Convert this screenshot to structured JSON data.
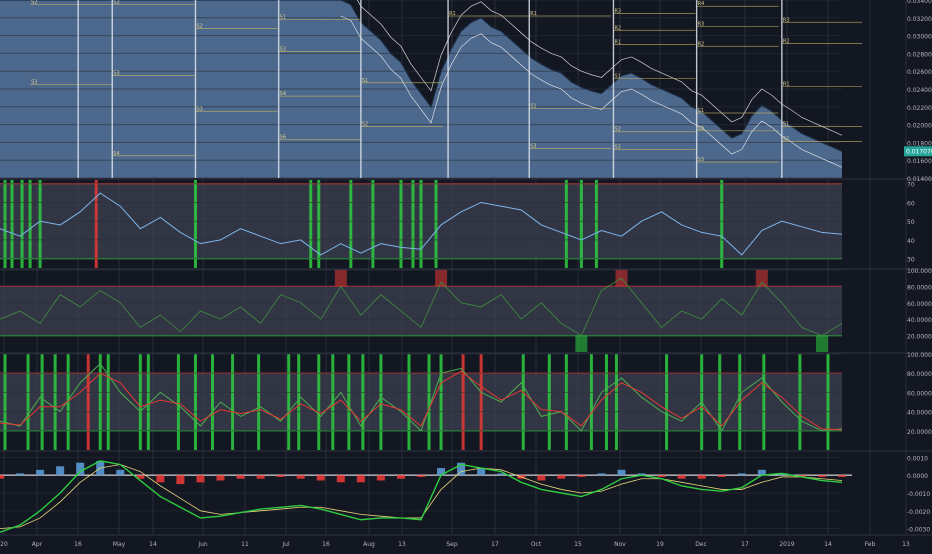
{
  "colors": {
    "background": "#131722",
    "price_area": "#4f6d92",
    "grid": "#2a2e39",
    "axis_text": "#b2b5be",
    "bull_candle": "#26a69a",
    "bear_candle": "#ef5350",
    "band_line": "#ffffff",
    "pivot_line": "#c8b560",
    "rsi_line": "#7cb5ec",
    "signal_green": "#2ecc40",
    "signal_red": "#e53935",
    "osc_fill": "#3d4150",
    "stoch_k": "#4caf50",
    "stoch_d": "#e53935",
    "macd_hist_pos": "#5b9bd5",
    "macd_hist_neg": "#e53935",
    "price_label_bg": "#26a69a"
  },
  "chart_data": [
    {
      "type": "line",
      "panel": "price",
      "y_tick_labels": [
        "0.034000",
        "0.032000",
        "0.030000",
        "0.028000",
        "0.026000",
        "0.024000",
        "0.022000",
        "0.020000",
        "0.018000",
        "0.016000",
        "0.014000"
      ],
      "ylim": [
        0.014,
        0.034
      ],
      "current_price_label": "0.017070",
      "x": [
        0,
        10,
        20,
        30,
        40,
        50,
        60,
        70,
        80,
        90,
        100,
        110,
        120,
        130,
        140,
        150,
        160,
        170,
        180,
        190,
        200,
        210,
        220,
        230,
        240,
        250,
        260,
        270,
        280,
        290,
        300,
        310,
        320,
        330,
        340,
        350,
        360,
        370,
        380,
        390,
        400,
        410,
        420,
        430,
        440,
        450,
        460,
        470,
        480,
        490,
        500,
        510,
        520,
        530,
        540,
        550,
        560,
        570,
        580,
        590,
        600,
        610,
        620,
        630,
        640,
        650,
        660,
        670,
        680,
        690,
        700,
        710,
        720,
        730,
        740,
        750,
        760,
        770,
        780,
        790,
        800,
        810,
        820,
        830,
        840
      ],
      "values": [
        0.0345,
        0.0345,
        0.0345,
        0.0345,
        0.0345,
        0.0345,
        0.0345,
        0.0345,
        0.0345,
        0.0345,
        0.0345,
        0.0345,
        0.0345,
        0.0345,
        0.0345,
        0.0345,
        0.0345,
        0.0345,
        0.0345,
        0.0345,
        0.0345,
        0.0345,
        0.0345,
        0.0345,
        0.0345,
        0.0345,
        0.0345,
        0.0345,
        0.0345,
        0.0345,
        0.0345,
        0.0345,
        0.0345,
        0.0345,
        0.034,
        0.0335,
        0.0315,
        0.0305,
        0.0295,
        0.028,
        0.027,
        0.025,
        0.0235,
        0.022,
        0.026,
        0.0285,
        0.0305,
        0.0315,
        0.032,
        0.031,
        0.0305,
        0.0295,
        0.0285,
        0.0275,
        0.0268,
        0.0262,
        0.0258,
        0.0248,
        0.0242,
        0.0238,
        0.0235,
        0.0245,
        0.0255,
        0.0258,
        0.0252,
        0.0245,
        0.024,
        0.0235,
        0.023,
        0.022,
        0.0215,
        0.0205,
        0.0195,
        0.0185,
        0.019,
        0.021,
        0.0222,
        0.0215,
        0.0205,
        0.0198,
        0.019,
        0.0185,
        0.018,
        0.0175,
        0.017
      ],
      "pivot_labels": [
        {
          "label": "S2",
          "x": 30,
          "y": 0.0335
        },
        {
          "label": "S2",
          "x": 112,
          "y": 0.0335
        },
        {
          "label": "S3",
          "x": 30,
          "y": 0.0245
        },
        {
          "label": "S3",
          "x": 112,
          "y": 0.0255
        },
        {
          "label": "S2",
          "x": 195,
          "y": 0.0308
        },
        {
          "label": "S3",
          "x": 195,
          "y": 0.0215
        },
        {
          "label": "S4",
          "x": 112,
          "y": 0.0165
        },
        {
          "label": "S1",
          "x": 278,
          "y": 0.0318
        },
        {
          "label": "S3",
          "x": 278,
          "y": 0.0282
        },
        {
          "label": "S4",
          "x": 278,
          "y": 0.0232
        },
        {
          "label": "S6",
          "x": 278,
          "y": 0.0183
        },
        {
          "label": "S1",
          "x": 360,
          "y": 0.0247
        },
        {
          "label": "S2",
          "x": 360,
          "y": 0.0198
        },
        {
          "label": "R1",
          "x": 447,
          "y": 0.0322
        },
        {
          "label": "R1",
          "x": 528,
          "y": 0.0322
        },
        {
          "label": "S1",
          "x": 528,
          "y": 0.0218
        },
        {
          "label": "S3",
          "x": 528,
          "y": 0.0173
        },
        {
          "label": "R3",
          "x": 612,
          "y": 0.0325
        },
        {
          "label": "R2",
          "x": 612,
          "y": 0.0306
        },
        {
          "label": "R1",
          "x": 612,
          "y": 0.029
        },
        {
          "label": "S1",
          "x": 612,
          "y": 0.0252
        },
        {
          "label": "S2",
          "x": 612,
          "y": 0.0192
        },
        {
          "label": "S3",
          "x": 612,
          "y": 0.0172
        },
        {
          "label": "R4",
          "x": 695,
          "y": 0.0333
        },
        {
          "label": "R3",
          "x": 695,
          "y": 0.031
        },
        {
          "label": "R2",
          "x": 695,
          "y": 0.0288
        },
        {
          "label": "S1",
          "x": 695,
          "y": 0.0213
        },
        {
          "label": "S2",
          "x": 695,
          "y": 0.0193
        },
        {
          "label": "S3",
          "x": 695,
          "y": 0.0158
        },
        {
          "label": "R3",
          "x": 780,
          "y": 0.0315
        },
        {
          "label": "R2",
          "x": 780,
          "y": 0.0291
        },
        {
          "label": "R1",
          "x": 780,
          "y": 0.0243
        },
        {
          "label": "S1",
          "x": 780,
          "y": 0.0198
        },
        {
          "label": "S2",
          "x": 780,
          "y": 0.0181
        }
      ]
    },
    {
      "type": "line",
      "panel": "rsi",
      "y_tick_labels": [
        "70",
        "60",
        "50",
        "40",
        "30"
      ],
      "ylim": [
        25,
        72
      ],
      "upper_band": 70,
      "lower_band": 30,
      "x": [
        0,
        20,
        40,
        60,
        80,
        100,
        120,
        140,
        160,
        180,
        200,
        220,
        240,
        260,
        280,
        300,
        320,
        340,
        360,
        380,
        400,
        420,
        440,
        460,
        480,
        500,
        520,
        540,
        560,
        580,
        600,
        620,
        640,
        660,
        680,
        700,
        720,
        740,
        760,
        780,
        800,
        820,
        840
      ],
      "values": [
        46,
        42,
        50,
        48,
        55,
        65,
        58,
        46,
        52,
        44,
        38,
        40,
        46,
        42,
        38,
        40,
        32,
        38,
        33,
        38,
        36,
        35,
        48,
        55,
        60,
        58,
        56,
        48,
        44,
        40,
        45,
        42,
        50,
        55,
        48,
        44,
        42,
        32,
        45,
        50,
        47,
        44,
        43
      ]
    },
    {
      "type": "line",
      "panel": "oscillator",
      "y_tick_labels": [
        "100.0000",
        "80.0000",
        "60.0000",
        "40.0000",
        "20.0000"
      ],
      "ylim": [
        0,
        100
      ],
      "upper_band": 80,
      "lower_band": 20,
      "x": [
        0,
        20,
        40,
        60,
        80,
        100,
        120,
        140,
        160,
        180,
        200,
        220,
        240,
        260,
        280,
        300,
        320,
        340,
        360,
        380,
        400,
        420,
        440,
        460,
        480,
        500,
        520,
        540,
        560,
        580,
        600,
        620,
        640,
        660,
        680,
        700,
        720,
        740,
        760,
        780,
        800,
        820,
        840
      ],
      "values": [
        40,
        50,
        35,
        70,
        55,
        75,
        60,
        30,
        45,
        25,
        50,
        40,
        55,
        35,
        70,
        60,
        40,
        80,
        45,
        70,
        50,
        30,
        85,
        60,
        55,
        70,
        40,
        60,
        35,
        20,
        75,
        90,
        60,
        30,
        50,
        40,
        65,
        45,
        85,
        60,
        30,
        20,
        35
      ]
    },
    {
      "type": "line",
      "panel": "stochastic",
      "y_tick_labels": [
        "100.0000",
        "80.0000",
        "60.0000",
        "40.0000",
        "20.0000"
      ],
      "ylim": [
        0,
        100
      ],
      "upper_band": 80,
      "lower_band": 20,
      "series": [
        {
          "x": [
            0,
            20,
            40,
            60,
            80,
            100,
            120,
            140,
            160,
            180,
            200,
            220,
            240,
            260,
            280,
            300,
            320,
            340,
            360,
            380,
            400,
            420,
            440,
            460,
            480,
            500,
            520,
            540,
            560,
            580,
            600,
            620,
            640,
            660,
            680,
            700,
            720,
            740,
            760,
            780,
            800,
            820,
            840
          ],
          "values": [
            30,
            25,
            55,
            40,
            70,
            90,
            60,
            40,
            60,
            45,
            25,
            50,
            35,
            45,
            30,
            55,
            35,
            60,
            25,
            55,
            40,
            20,
            80,
            85,
            60,
            50,
            70,
            35,
            40,
            20,
            60,
            75,
            55,
            40,
            30,
            50,
            20,
            60,
            75,
            50,
            30,
            20,
            22
          ]
        },
        {
          "x": [
            0,
            20,
            40,
            60,
            80,
            100,
            120,
            140,
            160,
            180,
            200,
            220,
            240,
            260,
            280,
            300,
            320,
            340,
            360,
            380,
            400,
            420,
            440,
            460,
            480,
            500,
            520,
            540,
            560,
            580,
            600,
            620,
            640,
            660,
            680,
            700,
            720,
            740,
            760,
            780,
            800,
            820,
            840
          ],
          "values": [
            28,
            26,
            45,
            45,
            60,
            80,
            70,
            45,
            52,
            48,
            30,
            42,
            38,
            42,
            32,
            48,
            38,
            52,
            30,
            48,
            42,
            25,
            70,
            82,
            66,
            52,
            62,
            42,
            40,
            25,
            52,
            70,
            60,
            45,
            33,
            45,
            25,
            52,
            70,
            55,
            35,
            22,
            21
          ]
        }
      ]
    },
    {
      "type": "bar",
      "panel": "macd",
      "y_tick_labels": [
        "0.0010",
        "0.0000",
        "-0.0010",
        "-0.0020",
        "-0.0030"
      ],
      "ylim": [
        -0.0033,
        0.0013
      ],
      "x": [
        0,
        20,
        40,
        60,
        80,
        100,
        120,
        140,
        160,
        180,
        200,
        220,
        240,
        260,
        280,
        300,
        320,
        340,
        360,
        380,
        400,
        420,
        440,
        460,
        480,
        500,
        520,
        540,
        560,
        580,
        600,
        620,
        640,
        660,
        680,
        700,
        720,
        740,
        760,
        780,
        800,
        820,
        840
      ],
      "histogram": [
        -0.0002,
        0.0001,
        0.0003,
        0.0005,
        0.0007,
        0.0008,
        0.0003,
        -0.0002,
        -0.0004,
        -0.0005,
        -0.0004,
        -0.0003,
        -0.0002,
        -0.0002,
        -0.0001,
        -0.0002,
        -0.0003,
        -0.0004,
        -0.0004,
        -0.0003,
        -0.0002,
        -0.0001,
        0.0004,
        0.0007,
        0.0004,
        0.0001,
        -0.0002,
        -0.0003,
        -0.0002,
        -0.0001,
        0.0001,
        0.0003,
        0.0001,
        -0.0001,
        -0.0002,
        -0.0002,
        -0.0001,
        0.0001,
        0.0003,
        0.0001,
        -0.0001,
        -0.0001,
        -0.0001
      ],
      "series": [
        {
          "x": [
            0,
            20,
            40,
            60,
            80,
            100,
            120,
            140,
            160,
            180,
            200,
            220,
            240,
            260,
            280,
            300,
            320,
            340,
            360,
            380,
            400,
            420,
            440,
            460,
            480,
            500,
            520,
            540,
            560,
            580,
            600,
            620,
            640,
            660,
            680,
            700,
            720,
            740,
            760,
            780,
            800,
            820,
            840
          ],
          "values": [
            -0.0032,
            -0.0028,
            -0.002,
            -0.001,
            0.0002,
            0.0008,
            0.0006,
            -0.0003,
            -0.0012,
            -0.0018,
            -0.0024,
            -0.0023,
            -0.0021,
            -0.0019,
            -0.0018,
            -0.0017,
            -0.0019,
            -0.0022,
            -0.0025,
            -0.0024,
            -0.0024,
            -0.0025,
            0.0,
            0.0006,
            0.0004,
            0.0002,
            -0.0004,
            -0.0008,
            -0.001,
            -0.0012,
            -0.0008,
            -0.0002,
            0.0,
            -0.0002,
            -0.0006,
            -0.0008,
            -0.0009,
            -0.0007,
            0.0,
            0.0001,
            -0.0001,
            -0.0003,
            -0.0004
          ]
        },
        {
          "x": [
            0,
            20,
            40,
            60,
            80,
            100,
            120,
            140,
            160,
            180,
            200,
            220,
            240,
            260,
            280,
            300,
            320,
            340,
            360,
            380,
            400,
            420,
            440,
            460,
            480,
            500,
            520,
            540,
            560,
            580,
            600,
            620,
            640,
            660,
            680,
            700,
            720,
            740,
            760,
            780,
            800,
            820,
            840
          ],
          "values": [
            -0.003,
            -0.0029,
            -0.0024,
            -0.0015,
            -0.0004,
            0.0004,
            0.0006,
            0.0002,
            -0.0006,
            -0.0013,
            -0.002,
            -0.0022,
            -0.0021,
            -0.002,
            -0.0019,
            -0.0018,
            -0.0018,
            -0.002,
            -0.0022,
            -0.0023,
            -0.0024,
            -0.0024,
            -0.0008,
            0.0002,
            0.0004,
            0.0003,
            -0.0001,
            -0.0005,
            -0.0008,
            -0.001,
            -0.0009,
            -0.0005,
            -0.0002,
            -0.0002,
            -0.0004,
            -0.0006,
            -0.0008,
            -0.0008,
            -0.0004,
            -0.0001,
            -0.0001,
            -0.0002,
            -0.0003
          ]
        }
      ]
    }
  ],
  "x_axis": {
    "ticks": [
      {
        "label": "20",
        "x": 4
      },
      {
        "label": "Apr",
        "x": 37
      },
      {
        "label": "16",
        "x": 78
      },
      {
        "label": "May",
        "x": 119
      },
      {
        "label": "14",
        "x": 153
      },
      {
        "label": "Jun",
        "x": 203
      },
      {
        "label": "11",
        "x": 245
      },
      {
        "label": "Jul",
        "x": 286
      },
      {
        "label": "16",
        "x": 326
      },
      {
        "label": "Aug",
        "x": 369
      },
      {
        "label": "13",
        "x": 402
      },
      {
        "label": "Sep",
        "x": 452
      },
      {
        "label": "17",
        "x": 495
      },
      {
        "label": "Oct",
        "x": 536
      },
      {
        "label": "15",
        "x": 578
      },
      {
        "label": "Nov",
        "x": 620
      },
      {
        "label": "19",
        "x": 660
      },
      {
        "label": "Dec",
        "x": 701
      },
      {
        "label": "17",
        "x": 745
      },
      {
        "label": "2019",
        "x": 787
      },
      {
        "label": "14",
        "x": 828
      },
      {
        "label": "Feb",
        "x": 870
      },
      {
        "label": "13",
        "x": 906
      }
    ]
  },
  "signals": {
    "rsi_green": [
      5,
      12,
      22,
      30,
      40,
      195,
      310,
      318,
      350,
      372,
      400,
      412,
      420,
      435,
      565,
      580,
      595,
      720
    ],
    "rsi_red": [
      96
    ],
    "stoch_green": [
      5,
      28,
      42,
      55,
      68,
      100,
      108,
      140,
      148,
      178,
      195,
      212,
      232,
      258,
      288,
      298,
      318,
      332,
      348,
      362,
      380,
      408,
      428,
      440,
      522,
      548,
      565,
      590,
      605,
      615,
      665,
      700,
      718,
      738,
      762,
      798,
      826
    ],
    "stoch_red": [
      88,
      462,
      480
    ]
  }
}
